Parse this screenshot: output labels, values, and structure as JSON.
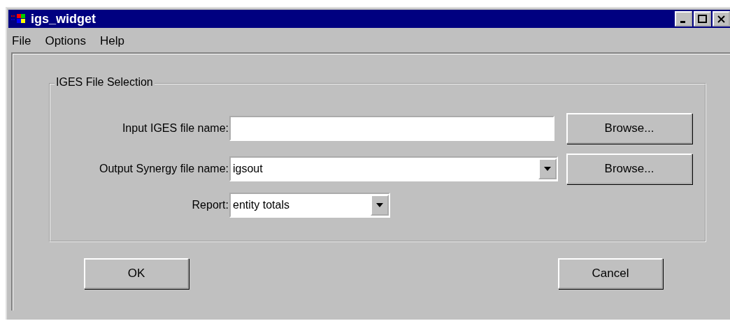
{
  "window": {
    "title": "igs_widget"
  },
  "menu": [
    {
      "label": "File"
    },
    {
      "label": "Options"
    },
    {
      "label": "Help"
    }
  ],
  "group": {
    "title": "IGES File Selection",
    "rows": [
      {
        "kind": "text",
        "label": "Input IGES file name:",
        "value": "",
        "button": "Browse..."
      },
      {
        "kind": "combo",
        "label": "Output Synergy file name:",
        "value": "igsout",
        "button": "Browse..."
      },
      {
        "kind": "short-combo",
        "label": "Report:",
        "value": "entity totals"
      }
    ]
  },
  "buttons": [
    "OK",
    "Cancel"
  ]
}
